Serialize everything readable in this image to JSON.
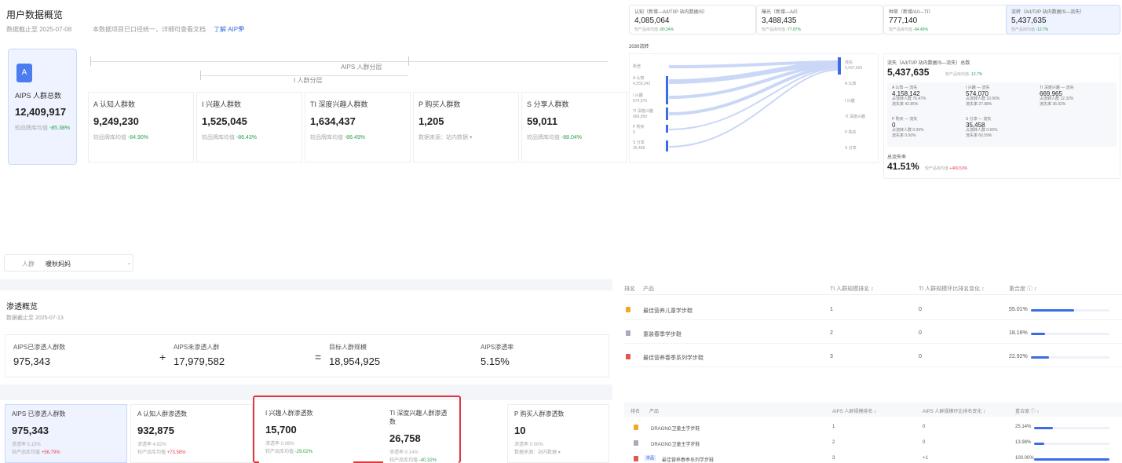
{
  "q1": {
    "title": "用户数据概览",
    "date_text": "数据截止至 2025-07-08",
    "notice_text": "本数据项目已口径统一，详细可查看文档",
    "notice_link": "了解 AIPS",
    "flow_label_outer": "AIPS 人群分层",
    "flow_label_inner": "I 人群分层",
    "total": {
      "label": "AIPS 人群总数",
      "value": "12,409,917",
      "sub_prefix": "较品牌库均值",
      "sub_value": "-85.38%"
    },
    "cards": [
      {
        "label": "A 认知人群数",
        "value": "9,249,230",
        "sub_prefix": "较品牌库均值",
        "sub_value": "-84.90%"
      },
      {
        "label": "I 兴趣人群数",
        "value": "1,525,045",
        "sub_prefix": "较品牌库均值",
        "sub_value": "-86.43%"
      },
      {
        "label": "TI 深度兴趣人群数",
        "value": "1,634,437",
        "sub_prefix": "较品牌库均值",
        "sub_value": "-86.49%"
      },
      {
        "label": "P 购买人群数",
        "value": "1,205",
        "sub_prefix": "数据来源：站内数据",
        "sub_value": ""
      },
      {
        "label": "S 分享人群数",
        "value": "59,011",
        "sub_prefix": "较品牌库均值",
        "sub_value": "-88.04%"
      }
    ]
  },
  "q2": {
    "top_cards": [
      {
        "title": "认知（新增—A/I/TI/P 站内数据/S）",
        "value": "4,085,064",
        "sub_prefix": "较产品库均值",
        "sub_value": "-80.34%"
      },
      {
        "title": "曝光（新增—A/I）",
        "value": "3,488,435",
        "sub_prefix": "较产品库均值",
        "sub_value": "-77.87%"
      },
      {
        "title": "种草（新增/A/I—TI）",
        "value": "777,140",
        "sub_prefix": "较产品库均值",
        "sub_value": "-84.49%"
      },
      {
        "title": "流转（A/I/TI/P 站内数据/S—流失）",
        "value": "5,437,635",
        "sub_prefix": "较产品库均值",
        "sub_value": "-12.7%"
      }
    ],
    "flow_title": "2030流转",
    "left_nodes": [
      {
        "label": "新增",
        "value": ""
      },
      {
        "label": "A 认知",
        "value": "4,259,242"
      },
      {
        "label": "I 兴趣",
        "value": "574,075"
      },
      {
        "label": "TI 深度兴趣",
        "value": "669,950"
      },
      {
        "label": "P 购买",
        "value": "0"
      },
      {
        "label": "S 分享",
        "value": "35,458"
      }
    ],
    "right_nodes": [
      {
        "label": "流失",
        "value": "5,437,635"
      },
      {
        "label": "A 认知",
        "value": ""
      },
      {
        "label": "I 兴趣",
        "value": ""
      },
      {
        "label": "TI 深度兴趣",
        "value": ""
      },
      {
        "label": "P 购买",
        "value": ""
      },
      {
        "label": "S 分享",
        "value": ""
      }
    ],
    "detail": {
      "title": "流失（A/I/TI/P 站内数据/S—流失）总数",
      "value": "5,437,635",
      "sub_prefix": "较产品库均值",
      "sub_value": "-12.7%",
      "cells": [
        {
          "title": "A 认知 — 流失",
          "value": "4,158,142",
          "l1": "占流转人群 76.47%",
          "l2": "流失率 42.85%"
        },
        {
          "title": "I 兴趣 — 流失",
          "value": "574,070",
          "l1": "占流转人群 10.56%",
          "l2": "流失率 27.88%"
        },
        {
          "title": "TI 深度兴趣 — 流失",
          "value": "669,965",
          "l1": "占流转人群 12.32%",
          "l2": "流失率 36.92%"
        },
        {
          "title": "P 购买 — 流失",
          "value": "0",
          "l1": "占流转人群 0.00%",
          "l2": "流失率 0.00%"
        },
        {
          "title": "S 分享 — 流失",
          "value": "35,458",
          "l1": "占流转人群 0.65%",
          "l2": "流失率 60.59%"
        }
      ],
      "rate_title": "总流失率",
      "rate_value": "41.51%",
      "rate_sub_prefix": "较产品库均值",
      "rate_sub_value": "+469.53%"
    }
  },
  "q3": {
    "selector_prefix": "人群",
    "selector_value": "暖秋妈妈",
    "section_title": "渗透概览",
    "date_text": "数据截止至 2025-07-13",
    "eq": {
      "a_label": "AIPS已渗透人群数",
      "a_value": "975,343",
      "plus": "+",
      "b_label": "AIPS未渗透人群",
      "b_value": "17,979,582",
      "equals": "=",
      "c_label": "目标人群规模",
      "c_value": "18,954,925",
      "d_label": "AIPS渗透率",
      "d_value": "5.15%"
    },
    "cards": [
      {
        "label": "AIPS 已渗透人群数",
        "value": "975,343",
        "l1": "渗透率 5.15%",
        "l2_prefix": "较产品库均值",
        "l2_value": "+56.79%"
      },
      {
        "label": "A 认知人群渗透数",
        "value": "932,875",
        "l1": "渗透率 4.92%",
        "l2_prefix": "较产品库均值",
        "l2_value": "+73.58%"
      },
      {
        "label": "I 兴趣人群渗透数",
        "value": "15,700",
        "l1": "渗透率 0.08%",
        "l2_prefix": "较产品库均值",
        "l2_value": "-29.02%"
      },
      {
        "label": "TI 深度兴趣人群渗透数",
        "value": "26,758",
        "l1": "渗透率 0.14%",
        "l2_prefix": "较产品库均值",
        "l2_value": "-40.32%"
      },
      {
        "label": "P 购买人群渗透数",
        "value": "10",
        "l1": "渗透率 0.00%",
        "l2_prefix": "数据来源：站内数据",
        "l2_value": ""
      }
    ]
  },
  "q4": {
    "table1": {
      "headers": [
        "排名",
        "产品",
        "TI 人群规模排名 ↕",
        "TI 人群规模环比排名变化 ↕",
        "重合度 ⓘ ↕"
      ],
      "rows": [
        {
          "rank": "1",
          "product": "最佳营养儿童学步鞋",
          "h": "1",
          "chg": "0",
          "pct": "55.01%",
          "frac": 0.55
        },
        {
          "rank": "2",
          "product": "童装春季学步鞋",
          "h": "2",
          "chg": "0",
          "pct": "18.16%",
          "frac": 0.18
        },
        {
          "rank": "3",
          "product": "最佳营养春季系列学步鞋",
          "h": "3",
          "chg": "0",
          "pct": "22.92%",
          "frac": 0.23
        }
      ]
    },
    "table2": {
      "headers": [
        "排名",
        "产品",
        "AIPS 人群规模排名 ↕",
        "AIPS 人群规模环比排名变化 ↕",
        "重合度 ⓘ ↕"
      ],
      "rows": [
        {
          "rank": "1",
          "product": "DRAGNG卫童主学步鞋",
          "h": "1",
          "chg": "0",
          "pct": "25.14%",
          "frac": 0.25
        },
        {
          "rank": "2",
          "product": "DRAGNG卫童主学步鞋",
          "h": "2",
          "chg": "0",
          "pct": "13.98%",
          "frac": 0.14
        },
        {
          "rank": "3",
          "product": "最佳营养春季系列学步鞋",
          "tag": "本品",
          "h": "3",
          "chg": "+1",
          "pct": "100.00%",
          "frac": 1.0
        }
      ]
    }
  },
  "colors": {
    "accent": "#3b6be6",
    "positive": "#2aa44a",
    "negative": "#e8394e",
    "highlight_border": "#e0363e",
    "gold": "#f5a623",
    "silver": "#a7adb8",
    "bronze": "#e0584c"
  }
}
